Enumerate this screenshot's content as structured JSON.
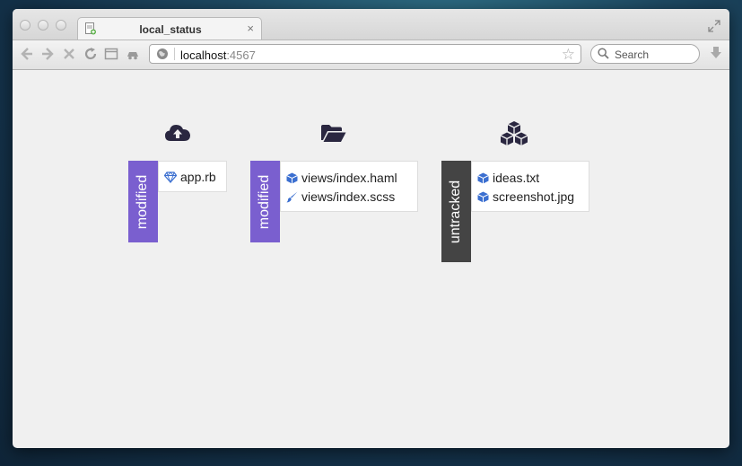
{
  "window": {
    "tab": {
      "title": "local_status",
      "close_glyph": "×",
      "favicon": "document-plus-icon"
    },
    "toolbar": {
      "back_icon": "back-arrow-icon",
      "forward_icon": "forward-arrow-icon",
      "stop_icon": "stop-icon",
      "reload_icon": "reload-icon",
      "url": {
        "host": "localhost",
        "port": ":4567"
      },
      "search_placeholder": "Search",
      "star_glyph": "☆"
    }
  },
  "groups": [
    {
      "icon": "cloud-upload-icon",
      "status": "modified",
      "files": [
        {
          "name": "app.rb",
          "icon": "ruby-gem-icon"
        }
      ]
    },
    {
      "icon": "folder-open-icon",
      "status": "modified",
      "files": [
        {
          "name": "views/index.haml",
          "icon": "cube-icon"
        },
        {
          "name": "views/index.scss",
          "icon": "brush-icon"
        }
      ]
    },
    {
      "icon": "cubes-icon",
      "status": "untracked",
      "files": [
        {
          "name": "ideas.txt",
          "icon": "cube-icon"
        },
        {
          "name": "screenshot.jpg",
          "icon": "cube-icon"
        }
      ]
    }
  ],
  "colors": {
    "modified": "#7a5fcf",
    "untracked": "#444444",
    "icon_dark": "#2a2740",
    "file_icon_blue": "#3b6fd0"
  }
}
